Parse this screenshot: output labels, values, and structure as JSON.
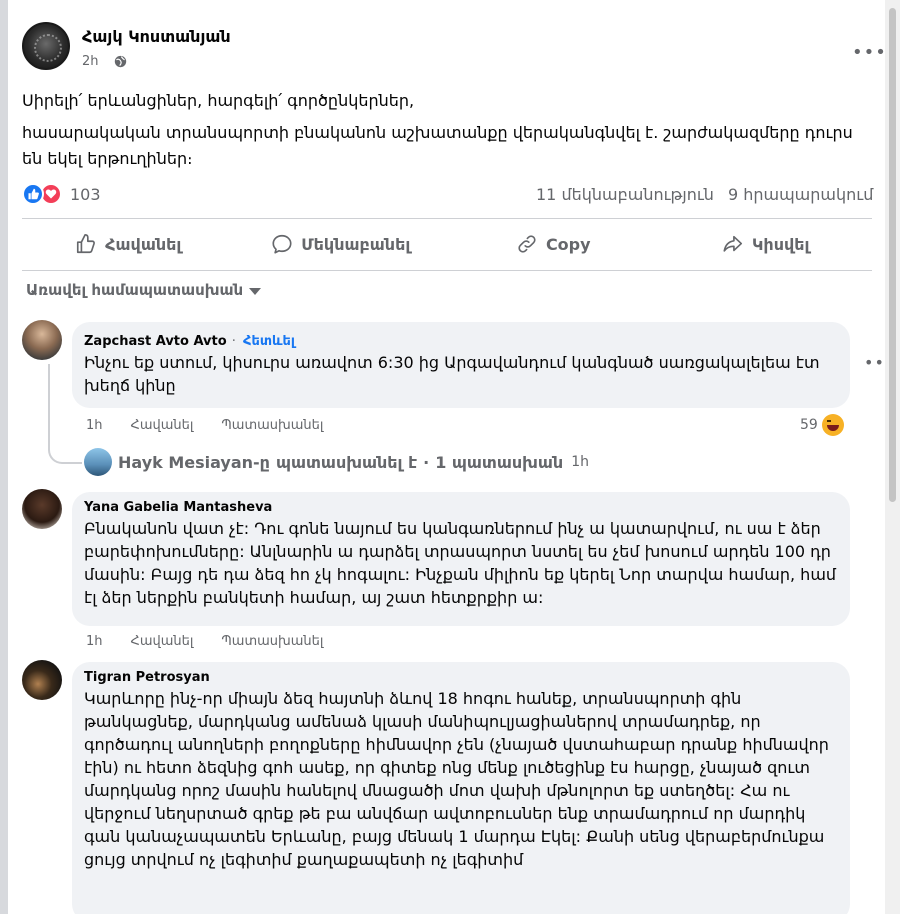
{
  "post": {
    "author": "Հայկ Կոստանյան",
    "time": "2h",
    "paragraphs": [
      "Սիրելի՛ երևանցիներ, հարգելի՛ գործընկերներ,",
      "հասարակական տրանսպորտի բնականոն աշխատանքը վերականգնվել է. շարժակազմերը դուրս են եկել երթուղիներ։"
    ],
    "reaction_count": "103",
    "comments_count": "11 մեկնաբանություն",
    "shares_count": "9 հրապարակում"
  },
  "actions": {
    "like": "Հավանել",
    "comment": "Մեկնաբանել",
    "copy": "Copy",
    "share": "Կիսվել"
  },
  "sort_label": "Առավել համապատասխան",
  "comments": [
    {
      "name": "Zapchast Avto Avto",
      "follow": "Հետևել",
      "text": "Ինչու եք ստում, կիսուրս առավոտ 6:30 ից Արգավանդում կանգնած սառցակալելեա էտ խեղճ կինը",
      "time": "1h",
      "like": "Հավանել",
      "reply": "Պատասխանել",
      "reaction_count": "59"
    },
    {
      "name": "Yana Gabelia Mantasheva",
      "text": "Բնականոն վատ չէ: Դու գոնե նայում ես կանգառներում ինչ ա կատարվում, ու սա է ձեր բարեփոխումները: Անլնարին ա դարձել տրասպորտ նստել ես չեմ խոսում արդեն 100 դր մասին: Բայց դե դա ձեզ հո չկ հոգալու: Ինչքան միլիոն եք կերել Նոր տարվա համար, համ էլ ձեր ներքին բանկետի համար, այ շատ հետքրքիր ա:",
      "time": "1h",
      "like": "Հավանել",
      "reply": "Պատասխանել"
    },
    {
      "name": "Tigran Petrosyan",
      "text": "Կարևորը ինչ-որ միայն ձեզ հայտնի ձևով 18 հոգու հանեք, տրանսպորտի գին թանկացնեք, մարդկանց ամենաձ կլասի մանիպուլյացիաներով տրամադրեք, որ գործադուլ անողների բողոքները հիմնավոր չեն (չնայած վստահաբար դրանք հիմնավոր էին) ու հետո ձեզնից գոհ ասեք, որ գիտեք ոնց մենք լուծեցինք էս հարցը, չնայած զուտ մարդկանց որոշ մասին հանելով մնացածի մոտ վախի մթնոլորտ եք ստեղծել: Հա ու վերջում նեղսրտած գրեք թե բա անվճար ավտոբուսներ ենք տրամադրում որ մարդիկ գան կանաչապատեն Երևանը, բայց մենակ 1 մարդա Էկել: Քանի սենց վերաբերմունքա ցույց տրվում ոչ լեգիտիմ քաղաքապետի ոչ լեգիտիմ"
    }
  ],
  "reply_summary": {
    "name": "Hayk Mesiayan-ը",
    "action": "պատասխանել է",
    "separator": "·",
    "count": "1 պատասխան",
    "time": "1h"
  },
  "colors": {
    "accent": "#1877f2",
    "secondary_text": "#65676b",
    "bubble": "#f0f2f5"
  },
  "icons": [
    "globe-icon",
    "more-icon",
    "like-reaction-icon",
    "love-reaction-icon",
    "thumbs-up-icon",
    "comment-icon",
    "copy-link-icon",
    "share-icon",
    "haha-reaction-icon"
  ]
}
